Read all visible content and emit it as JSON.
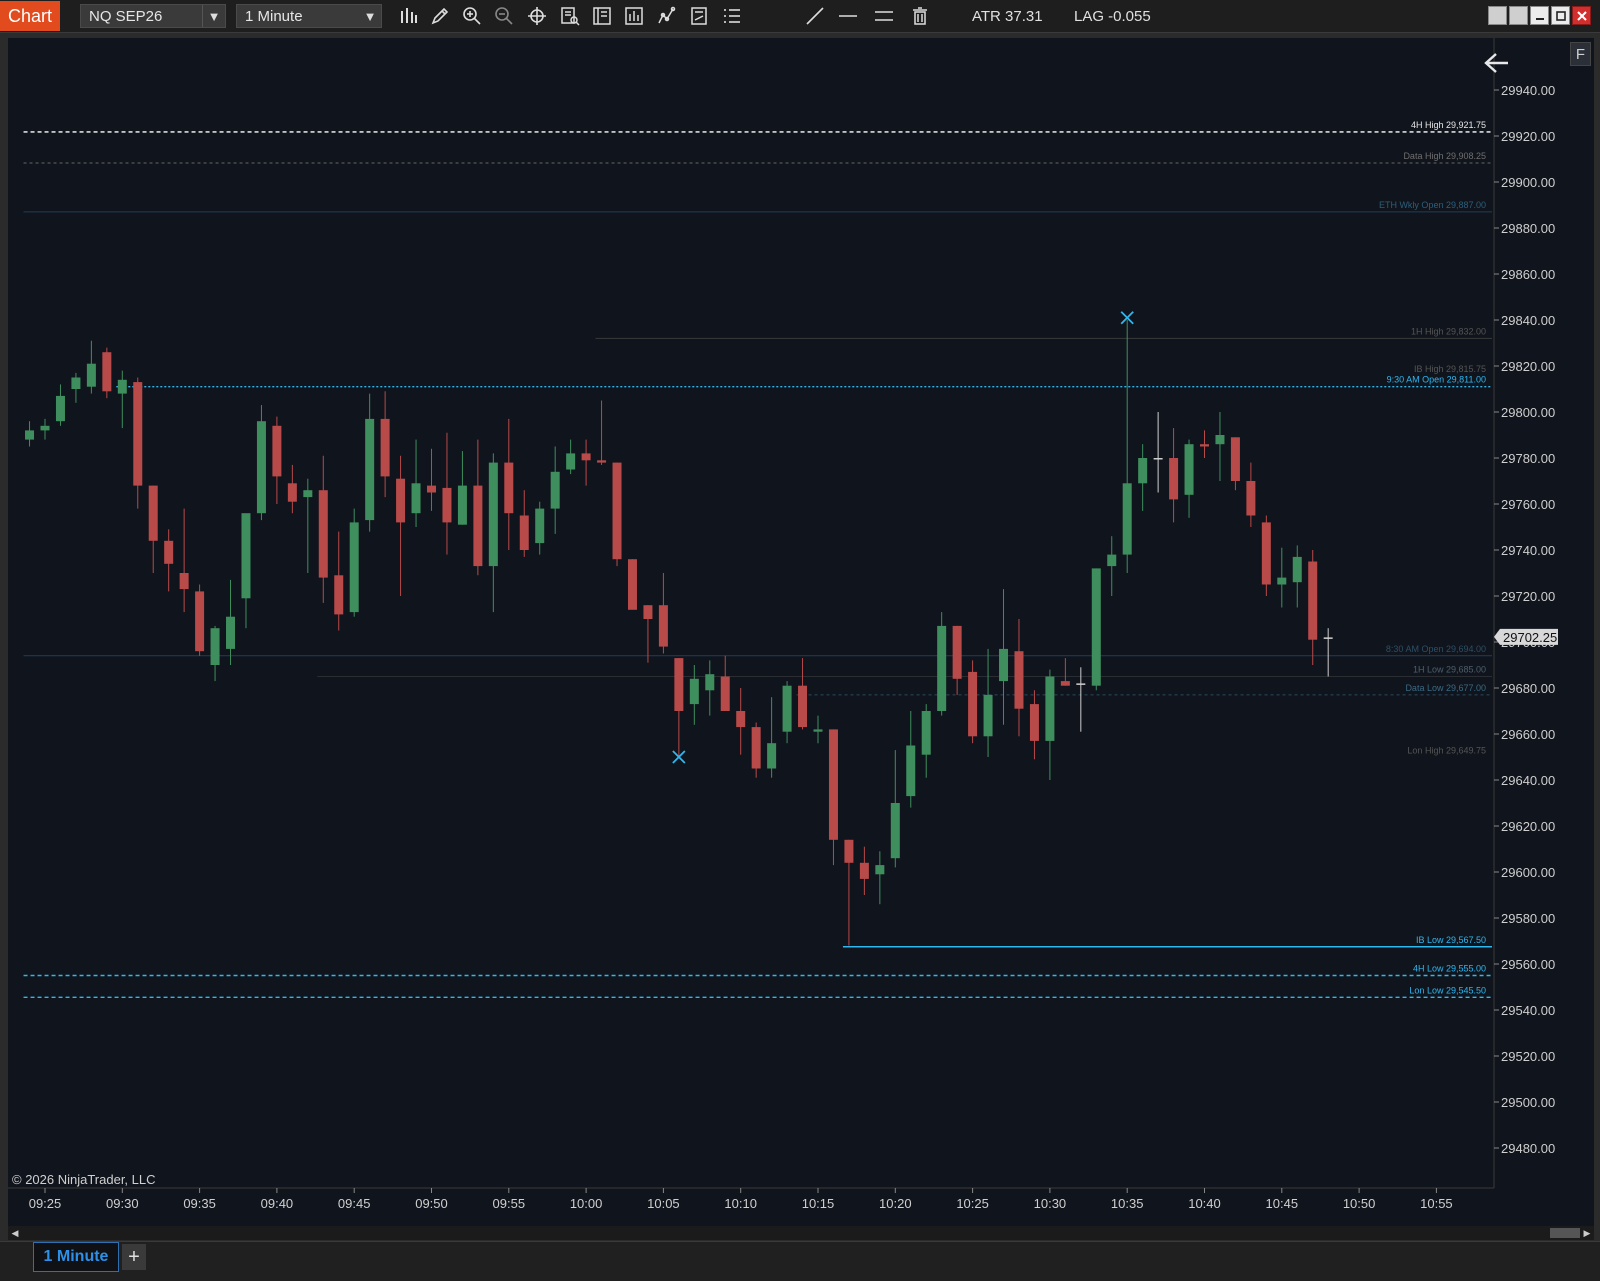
{
  "toolbar": {
    "app_title": "Chart",
    "instrument": "NQ SEP26",
    "interval": "1 Minute",
    "atr": "ATR 37.31",
    "lag": "LAG -0.055",
    "icons": [
      "bar-type-icon",
      "pencil-icon",
      "zoom-in-icon",
      "zoom-out-icon",
      "crosshair-icon",
      "data-box-icon",
      "properties-icon",
      "indicators-icon",
      "strategies-icon",
      "calculator-icon",
      "list-icon",
      "line-tool-icon",
      "horizontal-line-icon",
      "ray-lines-icon",
      "trash-icon"
    ]
  },
  "colors": {
    "background": "#10141c",
    "up_candle": "#3f8f5e",
    "down_candle": "#b84a4a",
    "accent_cyan": "#2fb7f0",
    "title_orange": "#e24b1e"
  },
  "copyright": "© 2026 NinjaTrader, LLC",
  "fullscreen_label": "F",
  "tabs": [
    {
      "label": "1 Minute",
      "active": true
    }
  ],
  "add_tab_label": "+",
  "chart_data": {
    "type": "candlestick",
    "instrument": "NQ SEP26",
    "interval": "1 Minute",
    "ylim": [
      29470,
      29950
    ],
    "y_ticks": [
      "29940.00",
      "29920.00",
      "29900.00",
      "29880.00",
      "29860.00",
      "29840.00",
      "29820.00",
      "29800.00",
      "29780.00",
      "29760.00",
      "29740.00",
      "29720.00",
      "29700.00",
      "29680.00",
      "29660.00",
      "29640.00",
      "29620.00",
      "29600.00",
      "29580.00",
      "29560.00",
      "29540.00",
      "29520.00",
      "29500.00",
      "29480.00"
    ],
    "x_ticks": [
      "09:25",
      "09:30",
      "09:35",
      "09:40",
      "09:45",
      "09:50",
      "09:55",
      "10:00",
      "10:05",
      "10:10",
      "10:15",
      "10:20",
      "10:25",
      "10:30",
      "10:35",
      "10:40",
      "10:45",
      "10:50",
      "10:55"
    ],
    "current_price": "29702.25",
    "candles": [
      {
        "t": "09:24",
        "o": 29788,
        "h": 29796,
        "l": 29785,
        "c": 29792
      },
      {
        "t": "09:25",
        "o": 29792,
        "h": 29797,
        "l": 29788,
        "c": 29794
      },
      {
        "t": "09:26",
        "o": 29796,
        "h": 29812,
        "l": 29794,
        "c": 29807
      },
      {
        "t": "09:27",
        "o": 29810,
        "h": 29817,
        "l": 29804,
        "c": 29815
      },
      {
        "t": "09:28",
        "o": 29811,
        "h": 29831,
        "l": 29808,
        "c": 29821
      },
      {
        "t": "09:29",
        "o": 29826,
        "h": 29828,
        "l": 29806,
        "c": 29809
      },
      {
        "t": "09:30",
        "o": 29808,
        "h": 29818,
        "l": 29793,
        "c": 29814
      },
      {
        "t": "09:31",
        "o": 29813,
        "h": 29815,
        "l": 29758,
        "c": 29768
      },
      {
        "t": "09:32",
        "o": 29768,
        "h": 29768,
        "l": 29730,
        "c": 29744
      },
      {
        "t": "09:33",
        "o": 29744,
        "h": 29749,
        "l": 29722,
        "c": 29734
      },
      {
        "t": "09:34",
        "o": 29730,
        "h": 29758,
        "l": 29713,
        "c": 29723
      },
      {
        "t": "09:35",
        "o": 29722,
        "h": 29725,
        "l": 29694,
        "c": 29696
      },
      {
        "t": "09:36",
        "o": 29690,
        "h": 29707,
        "l": 29683,
        "c": 29706
      },
      {
        "t": "09:37",
        "o": 29697,
        "h": 29727,
        "l": 29690,
        "c": 29711
      },
      {
        "t": "09:38",
        "o": 29719,
        "h": 29739,
        "l": 29706,
        "c": 29756
      },
      {
        "t": "09:39",
        "o": 29756,
        "h": 29803,
        "l": 29753,
        "c": 29796
      },
      {
        "t": "09:40",
        "o": 29794,
        "h": 29798,
        "l": 29760,
        "c": 29772
      },
      {
        "t": "09:41",
        "o": 29769,
        "h": 29777,
        "l": 29756,
        "c": 29761
      },
      {
        "t": "09:42",
        "o": 29763,
        "h": 29771,
        "l": 29730,
        "c": 29766
      },
      {
        "t": "09:43",
        "o": 29766,
        "h": 29781,
        "l": 29717,
        "c": 29728
      },
      {
        "t": "09:44",
        "o": 29729,
        "h": 29748,
        "l": 29705,
        "c": 29712
      },
      {
        "t": "09:45",
        "o": 29713,
        "h": 29758,
        "l": 29711,
        "c": 29752
      },
      {
        "t": "09:46",
        "o": 29753,
        "h": 29808,
        "l": 29748,
        "c": 29797
      },
      {
        "t": "09:47",
        "o": 29797,
        "h": 29809,
        "l": 29763,
        "c": 29772
      },
      {
        "t": "09:48",
        "o": 29771,
        "h": 29781,
        "l": 29720,
        "c": 29752
      },
      {
        "t": "09:49",
        "o": 29756,
        "h": 29788,
        "l": 29750,
        "c": 29769
      },
      {
        "t": "09:50",
        "o": 29768,
        "h": 29784,
        "l": 29757,
        "c": 29765
      },
      {
        "t": "09:51",
        "o": 29767,
        "h": 29791,
        "l": 29738,
        "c": 29752
      },
      {
        "t": "09:52",
        "o": 29751,
        "h": 29783,
        "l": 29751,
        "c": 29768
      },
      {
        "t": "09:53",
        "o": 29768,
        "h": 29788,
        "l": 29729,
        "c": 29733
      },
      {
        "t": "09:54",
        "o": 29733,
        "h": 29782,
        "l": 29713,
        "c": 29778
      },
      {
        "t": "09:55",
        "o": 29778,
        "h": 29797,
        "l": 29740,
        "c": 29756
      },
      {
        "t": "09:56",
        "o": 29755,
        "h": 29766,
        "l": 29737,
        "c": 29740
      },
      {
        "t": "09:57",
        "o": 29743,
        "h": 29761,
        "l": 29738,
        "c": 29758
      },
      {
        "t": "09:58",
        "o": 29758,
        "h": 29785,
        "l": 29747,
        "c": 29774
      },
      {
        "t": "09:59",
        "o": 29775,
        "h": 29788,
        "l": 29773,
        "c": 29782
      },
      {
        "t": "10:00",
        "o": 29782,
        "h": 29788,
        "l": 29768,
        "c": 29779
      },
      {
        "t": "10:01",
        "o": 29779,
        "h": 29805,
        "l": 29777,
        "c": 29778
      },
      {
        "t": "10:02",
        "o": 29778,
        "h": 29778,
        "l": 29733,
        "c": 29736
      },
      {
        "t": "10:03",
        "o": 29736,
        "h": 29736,
        "l": 29715,
        "c": 29714
      },
      {
        "t": "10:04",
        "o": 29716,
        "h": 29716,
        "l": 29691,
        "c": 29710
      },
      {
        "t": "10:05",
        "o": 29716,
        "h": 29730,
        "l": 29695,
        "c": 29698
      },
      {
        "t": "10:06",
        "o": 29693,
        "h": 29693,
        "l": 29650,
        "c": 29670
      },
      {
        "t": "10:07",
        "o": 29673,
        "h": 29690,
        "l": 29664,
        "c": 29684
      },
      {
        "t": "10:08",
        "o": 29679,
        "h": 29692,
        "l": 29668,
        "c": 29686
      },
      {
        "t": "10:09",
        "o": 29685,
        "h": 29694,
        "l": 29673,
        "c": 29670
      },
      {
        "t": "10:10",
        "o": 29670,
        "h": 29680,
        "l": 29651,
        "c": 29663
      },
      {
        "t": "10:11",
        "o": 29663,
        "h": 29665,
        "l": 29641,
        "c": 29645
      },
      {
        "t": "10:12",
        "o": 29645,
        "h": 29676,
        "l": 29641,
        "c": 29656
      },
      {
        "t": "10:13",
        "o": 29661,
        "h": 29683,
        "l": 29656,
        "c": 29681
      },
      {
        "t": "10:14",
        "o": 29681,
        "h": 29693,
        "l": 29662,
        "c": 29663
      },
      {
        "t": "10:15",
        "o": 29661,
        "h": 29668,
        "l": 29656,
        "c": 29662
      },
      {
        "t": "10:16",
        "o": 29662,
        "h": 29662,
        "l": 29603,
        "c": 29614
      },
      {
        "t": "10:17",
        "o": 29614,
        "h": 29614,
        "l": 29568,
        "c": 29604
      },
      {
        "t": "10:18",
        "o": 29604,
        "h": 29611,
        "l": 29590,
        "c": 29597
      },
      {
        "t": "10:19",
        "o": 29599,
        "h": 29609,
        "l": 29586,
        "c": 29603
      },
      {
        "t": "10:20",
        "o": 29606,
        "h": 29653,
        "l": 29602,
        "c": 29630
      },
      {
        "t": "10:21",
        "o": 29633,
        "h": 29670,
        "l": 29628,
        "c": 29655
      },
      {
        "t": "10:22",
        "o": 29651,
        "h": 29673,
        "l": 29641,
        "c": 29670
      },
      {
        "t": "10:23",
        "o": 29670,
        "h": 29713,
        "l": 29668,
        "c": 29707
      },
      {
        "t": "10:24",
        "o": 29707,
        "h": 29707,
        "l": 29677,
        "c": 29684
      },
      {
        "t": "10:25",
        "o": 29687,
        "h": 29692,
        "l": 29656,
        "c": 29659
      },
      {
        "t": "10:26",
        "o": 29659,
        "h": 29697,
        "l": 29650,
        "c": 29677
      },
      {
        "t": "10:27",
        "o": 29683,
        "h": 29723,
        "l": 29664,
        "c": 29697
      },
      {
        "t": "10:28",
        "o": 29696,
        "h": 29710,
        "l": 29659,
        "c": 29671
      },
      {
        "t": "10:29",
        "o": 29673,
        "h": 29679,
        "l": 29649,
        "c": 29657
      },
      {
        "t": "10:30",
        "o": 29657,
        "h": 29688,
        "l": 29640,
        "c": 29685
      },
      {
        "t": "10:31",
        "o": 29683,
        "h": 29693,
        "l": 29681,
        "c": 29681
      },
      {
        "t": "10:32",
        "o": 29682,
        "h": 29689,
        "l": 29661,
        "c": 29682
      },
      {
        "t": "10:33",
        "o": 29681,
        "h": 29732,
        "l": 29679,
        "c": 29732
      },
      {
        "t": "10:34",
        "o": 29733,
        "h": 29746,
        "l": 29720,
        "c": 29738
      },
      {
        "t": "10:35",
        "o": 29738,
        "h": 29840,
        "l": 29730,
        "c": 29769
      },
      {
        "t": "10:36",
        "o": 29769,
        "h": 29786,
        "l": 29757,
        "c": 29780
      },
      {
        "t": "10:37",
        "o": 29780,
        "h": 29800,
        "l": 29765,
        "c": 29780
      },
      {
        "t": "10:38",
        "o": 29780,
        "h": 29793,
        "l": 29752,
        "c": 29762
      },
      {
        "t": "10:39",
        "o": 29764,
        "h": 29788,
        "l": 29754,
        "c": 29786
      },
      {
        "t": "10:40",
        "o": 29786,
        "h": 29792,
        "l": 29780,
        "c": 29785
      },
      {
        "t": "10:41",
        "o": 29786,
        "h": 29800,
        "l": 29770,
        "c": 29790
      },
      {
        "t": "10:42",
        "o": 29789,
        "h": 29789,
        "l": 29766,
        "c": 29770
      },
      {
        "t": "10:43",
        "o": 29770,
        "h": 29778,
        "l": 29750,
        "c": 29755
      },
      {
        "t": "10:44",
        "o": 29752,
        "h": 29755,
        "l": 29720,
        "c": 29725
      },
      {
        "t": "10:45",
        "o": 29725,
        "h": 29741,
        "l": 29715,
        "c": 29728
      },
      {
        "t": "10:46",
        "o": 29726,
        "h": 29742,
        "l": 29715,
        "c": 29737
      },
      {
        "t": "10:47",
        "o": 29735,
        "h": 29740,
        "l": 29690,
        "c": 29701
      },
      {
        "t": "10:48",
        "o": 29702,
        "h": 29706,
        "l": 29685,
        "c": 29702
      }
    ],
    "levels": [
      {
        "label": "4H High",
        "value": "29,921.75",
        "y": 29921.75,
        "color": "#ffffff",
        "dash": "4,3",
        "start": "09:24",
        "label_color": "#e8e8e8"
      },
      {
        "label": "Data High",
        "value": "29,908.25",
        "y": 29908.25,
        "color": "#666666",
        "dash": "3,3",
        "start": "09:24",
        "label_color": "#6f6f6f"
      },
      {
        "label": "ETH Wkly Open",
        "value": "29,887.00",
        "y": 29887.0,
        "color": "#1f3f55",
        "dash": "",
        "start": "09:24",
        "label_color": "#2d5f7a"
      },
      {
        "label": "1H High",
        "value": "29,832.00",
        "y": 29832.0,
        "color": "#3a3a3a",
        "dash": "",
        "start": "10:01",
        "label_color": "#555555"
      },
      {
        "label": "9:30 AM Open",
        "value": "29,811.00",
        "y": 29811.0,
        "color": "#2fb7f0",
        "dash": "2,2",
        "start": "09:30",
        "label_color": "#2fb7f0"
      },
      {
        "label": "IB High",
        "value": "29,815.75",
        "y": 29815.75,
        "color": "",
        "dash": "",
        "start": "",
        "label_color": "#555555"
      },
      {
        "label": "8:30 AM Open",
        "value": "29,694.00",
        "y": 29694.0,
        "color": "#1f3f55",
        "dash": "",
        "start": "09:24",
        "label_color": "#2d4f66"
      },
      {
        "label": "1H Low",
        "value": "29,685.00",
        "y": 29685.0,
        "color": "#2a2e33",
        "dash": "",
        "start": "09:43",
        "label_color": "#4d5f6e"
      },
      {
        "label": "Data Low",
        "value": "29,677.00",
        "y": 29677.0,
        "color": "#2a4a5e",
        "dash": "3,3",
        "start": "10:14",
        "label_color": "#3a6a85"
      },
      {
        "label": "Lon High",
        "value": "29,649.75",
        "y": 29649.75,
        "color": "",
        "dash": "",
        "start": "",
        "label_color": "#555555"
      },
      {
        "label": "IB Low",
        "value": "29,567.50",
        "y": 29567.5,
        "color": "#2fb7f0",
        "dash": "",
        "start": "10:17",
        "label_color": "#2fb7f0"
      },
      {
        "label": "4H Low",
        "value": "29,555.00",
        "y": 29555.0,
        "color": "#2fb7f0",
        "dash": "4,3",
        "start": "09:24",
        "label_color": "#2fb7f0"
      },
      {
        "label": "Lon Low",
        "value": "29,545.50",
        "y": 29545.5,
        "color": "#2fb7f0",
        "dash": "4,3",
        "start": "09:24",
        "label_color": "#2fb7f0"
      }
    ],
    "markers": [
      {
        "t": "10:06",
        "y": 29650
      },
      {
        "t": "10:35",
        "y": 29841
      }
    ]
  }
}
